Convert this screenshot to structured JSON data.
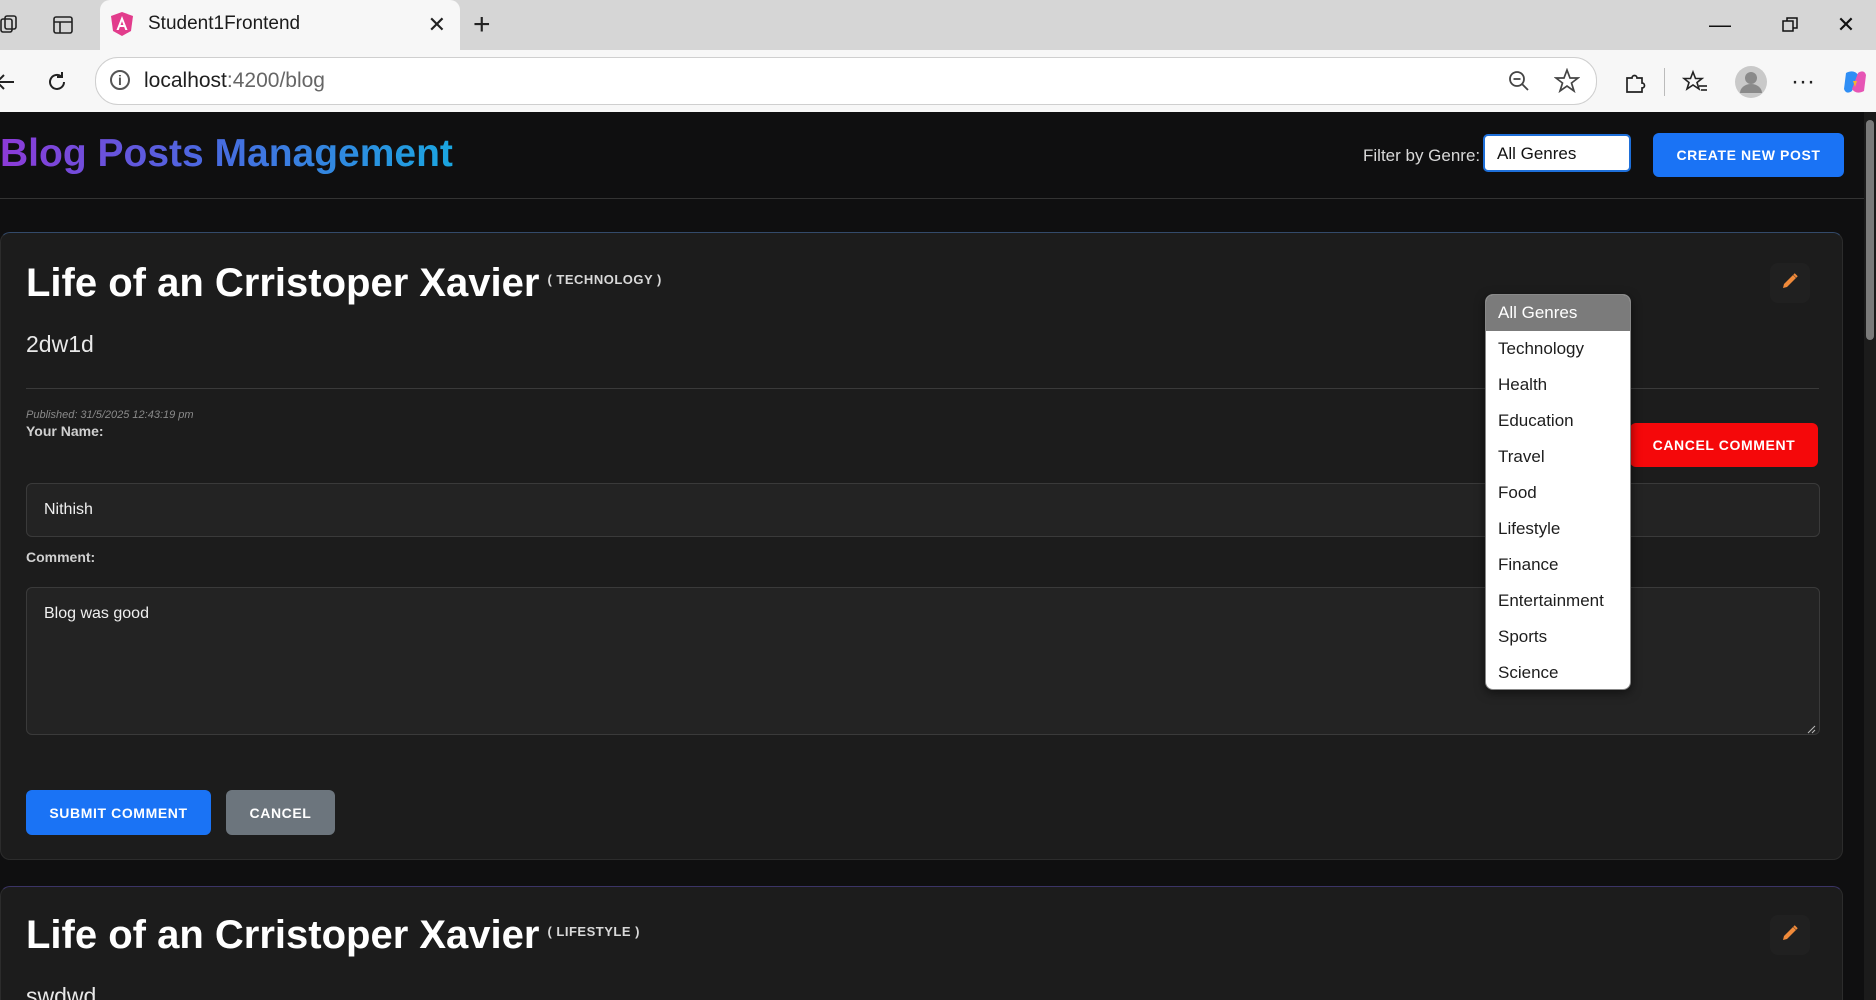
{
  "browser": {
    "tab_title": "Student1Frontend",
    "url_host": "localhost",
    "url_path": ":4200/blog"
  },
  "header": {
    "title": "Blog Posts Management",
    "filter_label": "Filter by Genre:",
    "filter_value": "All Genres",
    "create_button": "CREATE NEW POST"
  },
  "genre_options": [
    "All Genres",
    "Technology",
    "Health",
    "Education",
    "Travel",
    "Food",
    "Lifestyle",
    "Finance",
    "Entertainment",
    "Sports",
    "Science"
  ],
  "posts": [
    {
      "title": "Life of an Crristoper Xavier",
      "genre": "( TECHNOLOGY )",
      "body": "2dw1d",
      "published": "Published: 31/5/2025 12:43:19 pm",
      "comment_form": {
        "name_label": "Your Name:",
        "name_value": "Nithish",
        "comment_label": "Comment:",
        "comment_value": "Blog was good",
        "cancel_comment_button": "CANCEL COMMENT",
        "submit_button": "SUBMIT COMMENT",
        "cancel_button": "CANCEL"
      }
    },
    {
      "title": "Life of an Crristoper Xavier",
      "genre": "( LIFESTYLE )",
      "body": "swdwd"
    }
  ],
  "colors": {
    "primary": "#1a73f5",
    "danger": "#f5080a",
    "secondary": "#6c757d",
    "edit_icon": "#f08a3a"
  }
}
